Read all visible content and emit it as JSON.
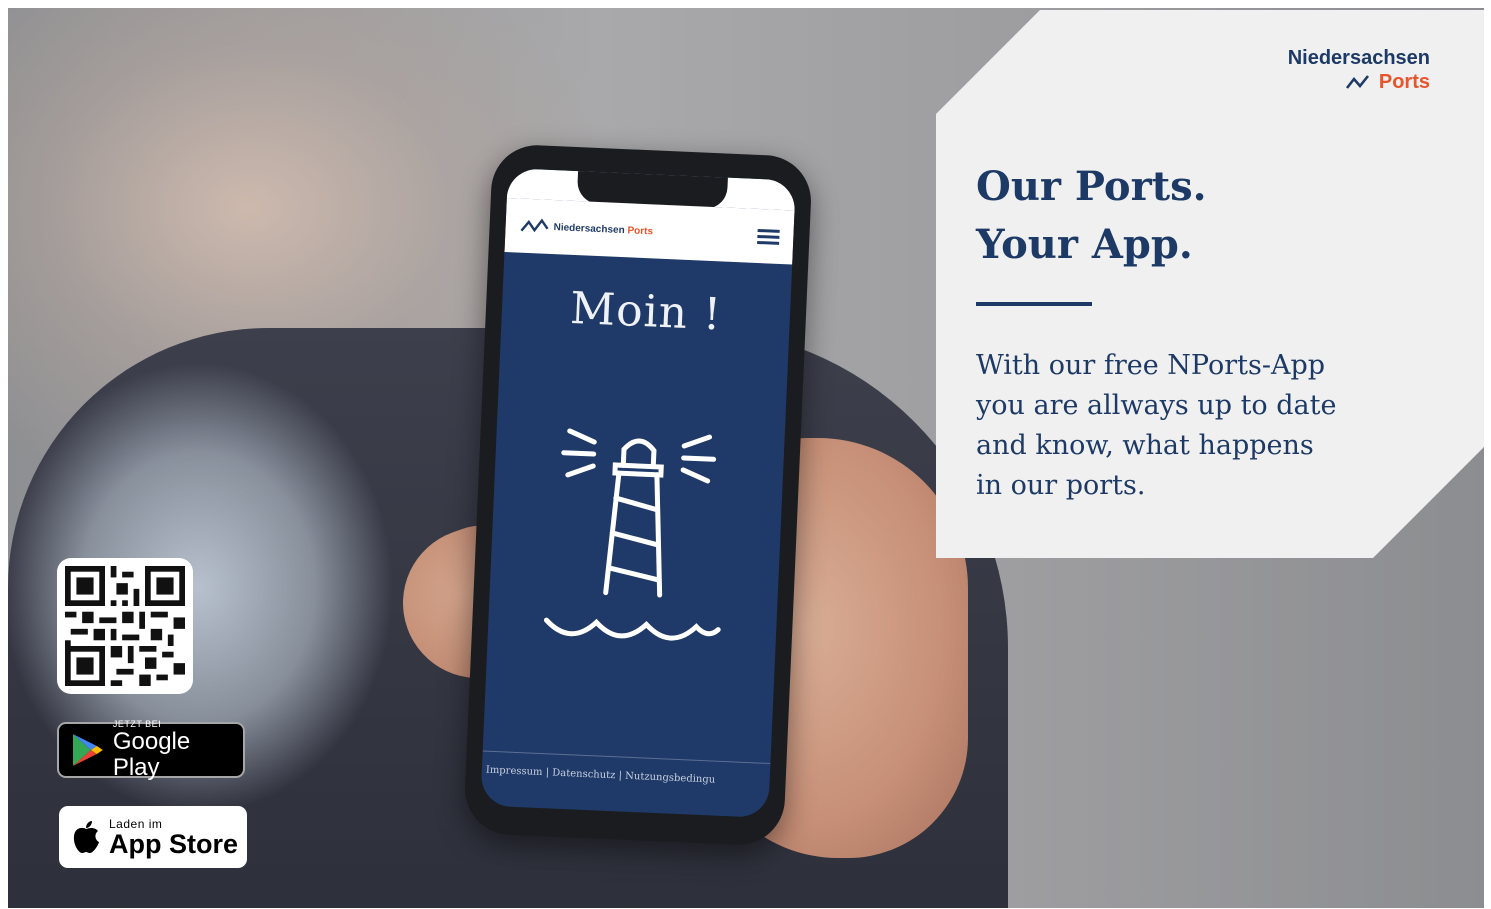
{
  "panel": {
    "brand_name": "Niedersachsen",
    "brand_sub": "Ports",
    "headline_line1": "Our Ports.",
    "headline_line2": "Your App.",
    "body_line1": "With our free NPorts-App",
    "body_line2": "you are allways up to date",
    "body_line3": "and know, what happens",
    "body_line4": "in our ports."
  },
  "phone": {
    "app_logo_name": "Niedersachsen",
    "app_logo_ports": "Ports",
    "greeting": "Moin !",
    "footer_links": "Impressum | Datenschutz | Nutzungsbedingu"
  },
  "badges": {
    "google_small": "JETZT BEI",
    "google_large": "Google Play",
    "apple_small": "Laden im",
    "apple_large": "App Store"
  },
  "colors": {
    "navy": "#1d3a66",
    "accent_orange": "#e8542c",
    "panel_bg": "#f0f0f1"
  }
}
